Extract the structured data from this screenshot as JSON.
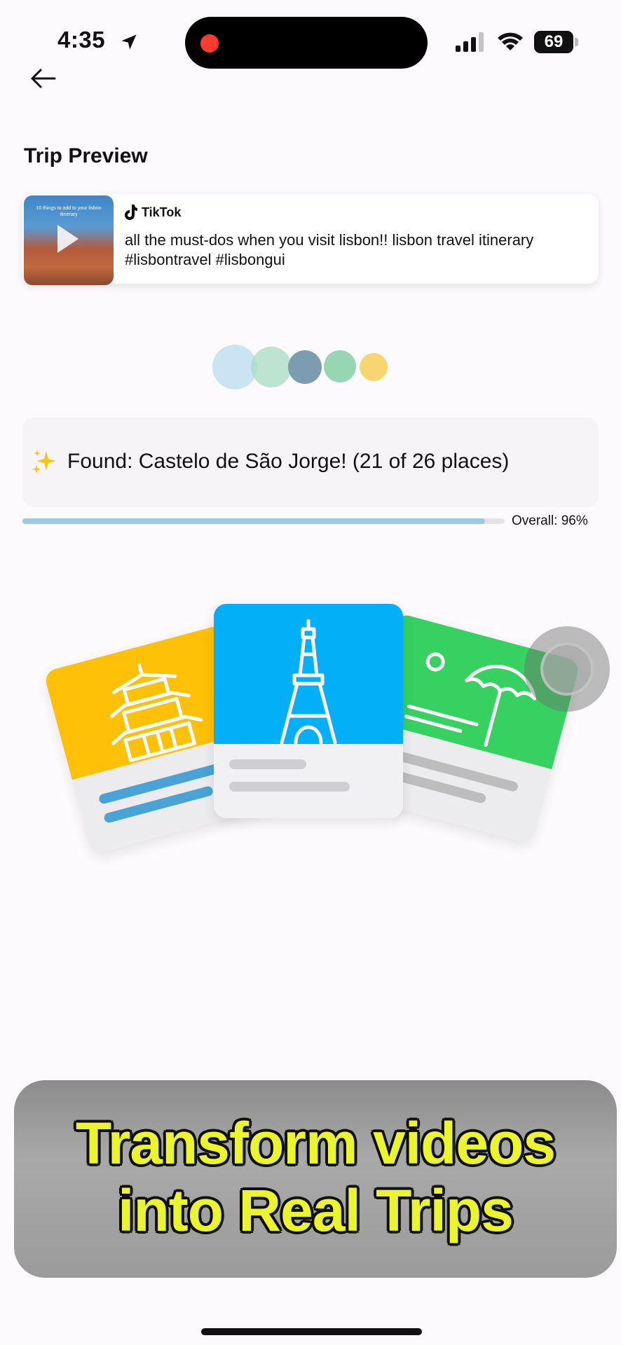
{
  "status_bar": {
    "time": "4:35",
    "battery": "69",
    "icons": [
      "location-arrow-icon",
      "cellular-signal-icon",
      "wifi-icon",
      "battery-icon"
    ]
  },
  "header": {
    "back_icon": "arrow-left-icon",
    "title": "Trip Preview"
  },
  "preview": {
    "source": "TikTok",
    "caption": "all the must-dos when you visit lisbon!!  lisbon travel itinerary #lisbontravel #lisbongui",
    "thumbnail_caption": "10 things to add to your lisbon itinerary"
  },
  "status": {
    "text": "Found: Castelo de São Jorge! (21 of 26 places)",
    "progress": 0.96,
    "progress_label": "Overall: 96%"
  },
  "loading_dots": {
    "colors": [
      "#a9d6ec",
      "#a7dcc2",
      "#7d9bb1",
      "#96d6b3",
      "#f7d671"
    ]
  },
  "illustration": {
    "cards": [
      {
        "icon": "pagoda-icon",
        "color": "#ffc107"
      },
      {
        "icon": "eiffel-tower-icon",
        "color": "#03b0f7"
      },
      {
        "icon": "beach-umbrella-icon",
        "color": "#36d160"
      }
    ]
  },
  "overlay_caption": {
    "line1": "Transform videos",
    "line2": "into Real Trips"
  }
}
